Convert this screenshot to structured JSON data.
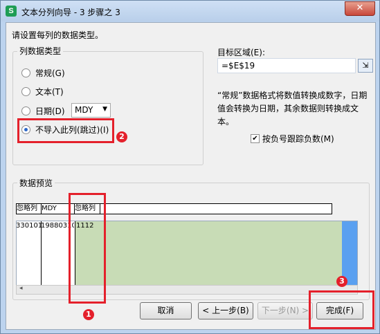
{
  "window": {
    "title": "文本分列向导 - 3 步骤之 3",
    "app_icon": "S",
    "close_glyph": "✕"
  },
  "prompt": "请设置每列的数据类型。",
  "column_type": {
    "legend": "列数据类型",
    "options": [
      "常规(G)",
      "文本(T)",
      "日期(D)",
      "不导入此列(跳过)(I)"
    ],
    "selected": "不导入此列(跳过)(I)",
    "date_format": "MDY",
    "dropdown_arrow": "▼"
  },
  "target": {
    "label": "目标区域(E):",
    "value": "=$E$19",
    "picker_icon": "range-picker-icon"
  },
  "description": "“常规”数据格式将数值转换成数字，日期值会转换为日期，其余数据则转换成文本。",
  "negative_checkbox": {
    "label": "按负号跟踪负数(M)",
    "checked": true,
    "mark": "✔"
  },
  "preview": {
    "legend": "数据预览",
    "headers": [
      "忽略列",
      "MDY",
      "忽略列"
    ],
    "row": [
      "330101",
      "19880310",
      "1112"
    ]
  },
  "buttons": {
    "cancel": "取消",
    "back": "< 上一步(B)",
    "next": "下一步(N) >",
    "finish": "完成(F)"
  },
  "annotations": {
    "markers": [
      "1",
      "2",
      "3"
    ],
    "color": "#e4202b"
  }
}
